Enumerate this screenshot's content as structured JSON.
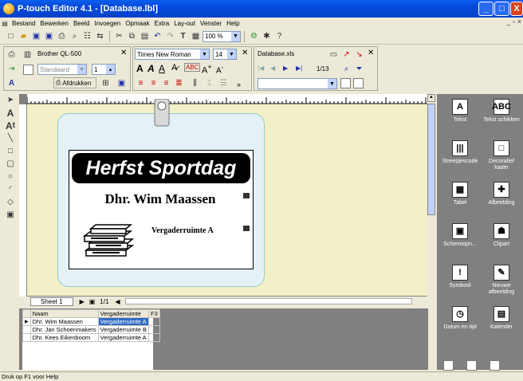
{
  "window": {
    "title": "P-touch Editor 4.1 - [Database.lbl]",
    "minimize": "_",
    "maximize": "□",
    "close": "X"
  },
  "menu": [
    "Bestand",
    "Bewerken",
    "Beeld",
    "Invoegen",
    "Opmaak",
    "Extra",
    "Lay-out",
    "Venster",
    "Help"
  ],
  "mdi_controls": "_ ▫ ×",
  "toolbar": {
    "zoom": "100 %"
  },
  "printer_panel": {
    "printer": "Brother QL-500",
    "style": "Standaard",
    "copies": "1",
    "print_label": "Afdrukken"
  },
  "font_panel": {
    "font": "Times New Roman",
    "size": "14"
  },
  "db_panel": {
    "file": "Database.xls",
    "record": "1/13"
  },
  "label": {
    "banner": "Herfst Sportdag",
    "name": "Dhr. Wim Maassen",
    "room": "Vergaderruimte A"
  },
  "sheet": {
    "tab": "Sheet 1",
    "page": "1/1"
  },
  "grid": {
    "columns": [
      "Naam",
      "Vergaderruimte",
      "F3"
    ],
    "rows": [
      [
        "Dhr. Wim Maassen",
        "Vergaderruimte A",
        ""
      ],
      [
        "Dhr. Jan Schoenmakers",
        "Vergaderruimte B",
        ""
      ],
      [
        "Dhr. Kees Eikenboom",
        "Vergaderruimte A",
        ""
      ]
    ]
  },
  "objects": [
    {
      "label": "Tekst",
      "icon": "A"
    },
    {
      "label": "Tekst schikken",
      "icon": "ABC"
    },
    {
      "label": "Streepjescode",
      "icon": "|||"
    },
    {
      "label": "Decoratief kader",
      "icon": "□"
    },
    {
      "label": "Tabel",
      "icon": "▦"
    },
    {
      "label": "Afbeelding",
      "icon": "✚"
    },
    {
      "label": "Schermopn...",
      "icon": "▣"
    },
    {
      "label": "Clipart",
      "icon": "☗"
    },
    {
      "label": "Symbool",
      "icon": "!"
    },
    {
      "label": "Nieuwe afbeelding",
      "icon": "✎"
    },
    {
      "label": "Datum en tijd",
      "icon": "◷"
    },
    {
      "label": "Kalender",
      "icon": "▤"
    }
  ],
  "status": "Druk op F1 voor Help"
}
